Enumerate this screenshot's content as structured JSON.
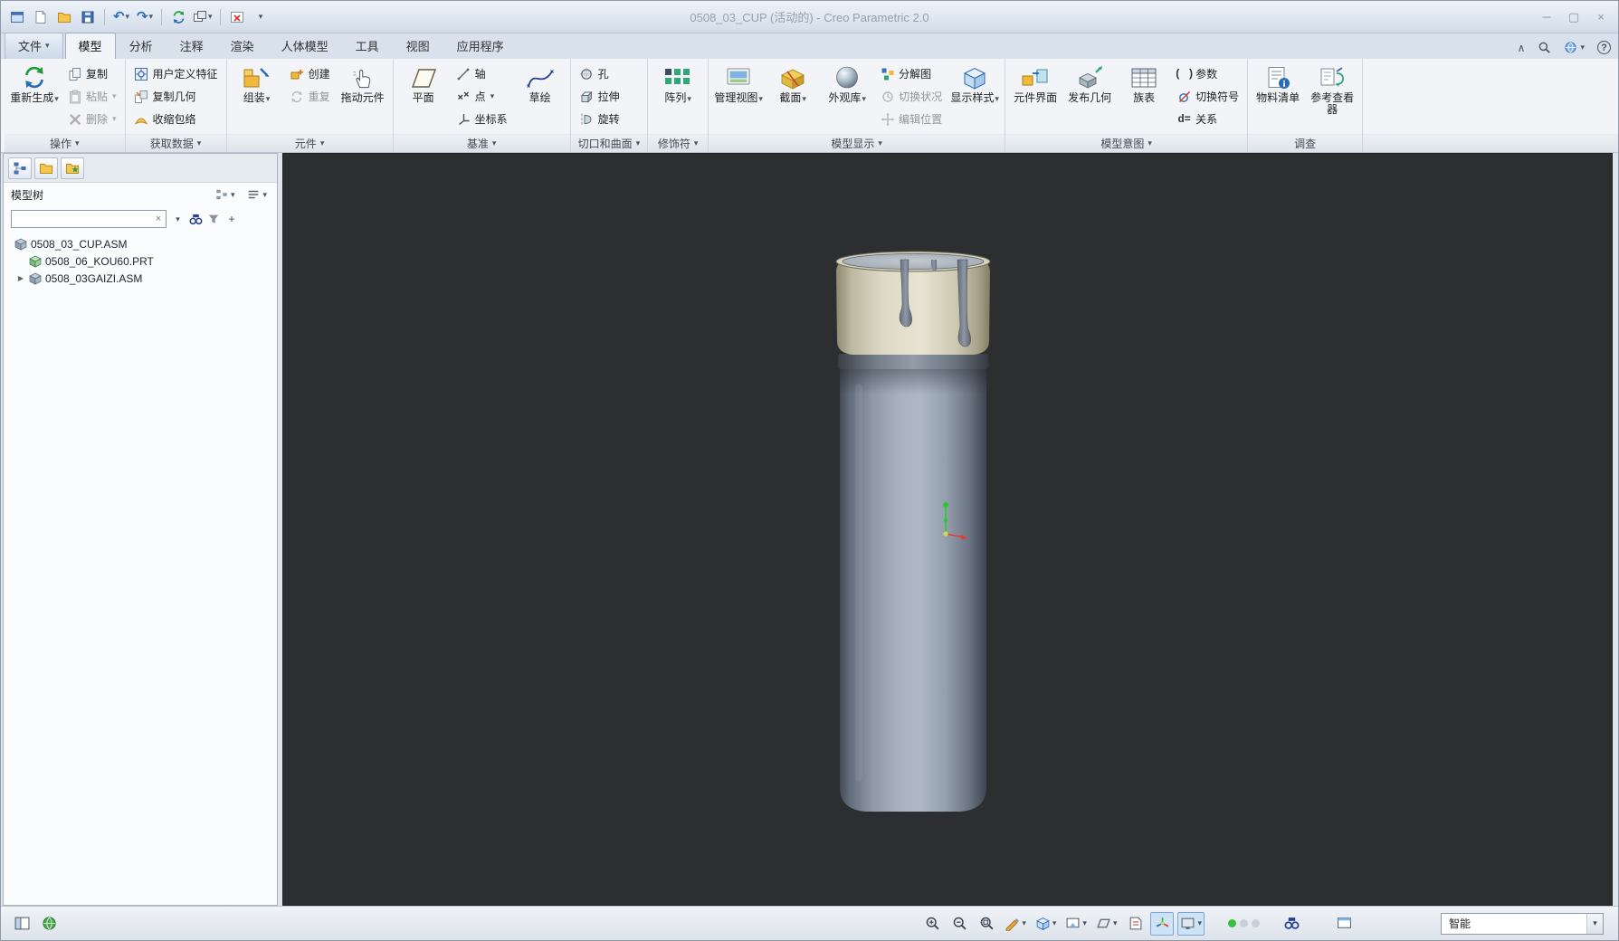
{
  "window": {
    "title": "0508_03_CUP (活动的) - Creo Parametric 2.0",
    "controls": {
      "minimize": "─",
      "restore": "▢",
      "close": "×"
    }
  },
  "glyphs": {
    "caret": "▾",
    "undo": "↶",
    "redo": "↷",
    "collapse": "∧",
    "help": "?",
    "clear": "×",
    "add": "+",
    "expand_arrow": "▶",
    "params": "( )",
    "relations": "d="
  },
  "tabs": {
    "file": "文件",
    "model": "模型",
    "analysis": "分析",
    "annotate": "注释",
    "render": "渲染",
    "manikin": "人体模型",
    "tools": "工具",
    "view": "视图",
    "applications": "应用程序"
  },
  "ribbon": {
    "operations": {
      "label": "操作",
      "regenerate": "重新生成",
      "copy": "复制",
      "paste": "粘贴",
      "delete": "删除"
    },
    "get_data": {
      "label": "获取数据",
      "udf": "用户定义特征",
      "copy_geometry": "复制几何",
      "shrinkwrap": "收缩包络"
    },
    "component": {
      "label": "元件",
      "assemble": "组装",
      "create": "创建",
      "repeat": "重复",
      "drag_component": "拖动元件"
    },
    "datum": {
      "label": "基准",
      "plane": "平面",
      "axis": "轴",
      "point": "点",
      "csys": "坐标系",
      "sketch": "草绘"
    },
    "cut_surface": {
      "label": "切口和曲面",
      "hole": "孔",
      "extrude": "拉伸",
      "revolve": "旋转"
    },
    "modifiers": {
      "label": "修饰符",
      "pattern": "阵列"
    },
    "model_display": {
      "label": "模型显示",
      "manage_views": "管理视图",
      "section": "截面",
      "appearance_gallery": "外观库",
      "exploded_view": "分解图",
      "toggle_status": "切换状况",
      "edit_position": "编辑位置",
      "display_style": "显示样式"
    },
    "model_intent": {
      "label": "模型意图",
      "component_interface": "元件界面",
      "publish_geometry": "发布几何",
      "family_table": "族表",
      "parameters": "参数",
      "switch_symbols": "切换符号",
      "relations": "关系"
    },
    "investigate": {
      "label": "调查",
      "bom": "物料清单",
      "reference_viewer": "参考查看器"
    }
  },
  "navigator": {
    "title": "模型树",
    "search_value": "",
    "tree": [
      {
        "label": "0508_03_CUP.ASM"
      },
      {
        "label": "0508_06_KOU60.PRT"
      },
      {
        "label": "0508_03GAIZI.ASM"
      }
    ]
  },
  "statusbar": {
    "selection_filter": "智能"
  },
  "colors": {
    "viewport_bg": "#2d2e30",
    "cap": "#ddd9c3",
    "body_metal": "#9aa4b2",
    "accent_blue": "#2b6cb8",
    "status_ok": "#35c23d"
  }
}
